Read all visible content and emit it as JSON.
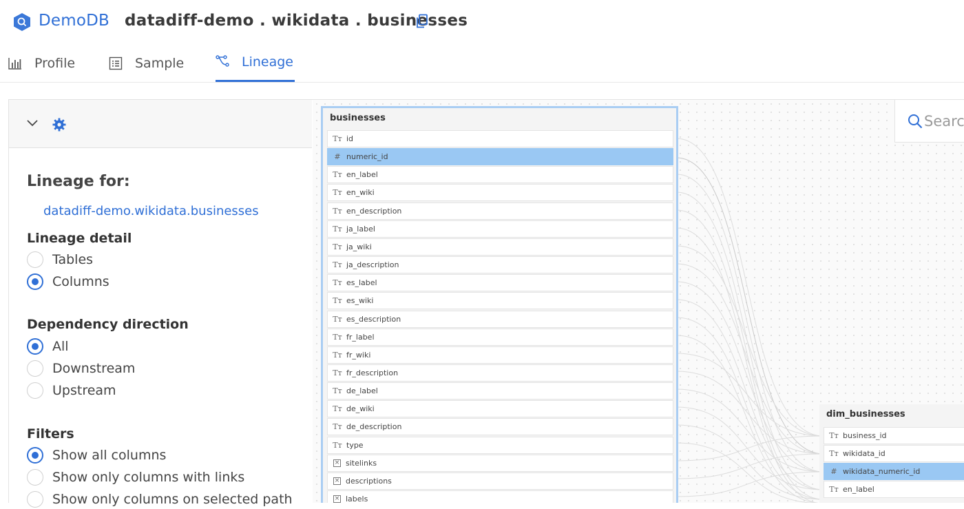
{
  "header": {
    "brand": "DemoDB",
    "table_path": "datadiff-demo . wikidata . businesses",
    "logo_icon": "hexagon-logo-icon",
    "copy_icon": "copy-icon"
  },
  "tabs": [
    {
      "label": "Profile",
      "icon": "bar-chart-icon",
      "active": false
    },
    {
      "label": "Sample",
      "icon": "list-icon",
      "active": false
    },
    {
      "label": "Lineage",
      "icon": "lineage-icon",
      "active": true
    }
  ],
  "panel": {
    "lineage_for_label": "Lineage for:",
    "lineage_for_link": "datadiff-demo.wikidata.businesses",
    "lineage_detail": {
      "title": "Lineage detail",
      "options": [
        {
          "label": "Tables",
          "selected": false
        },
        {
          "label": "Columns",
          "selected": true
        }
      ]
    },
    "dependency_direction": {
      "title": "Dependency direction",
      "options": [
        {
          "label": "All",
          "selected": true
        },
        {
          "label": "Downstream",
          "selected": false
        },
        {
          "label": "Upstream",
          "selected": false
        }
      ]
    },
    "filters": {
      "title": "Filters",
      "options": [
        {
          "label": "Show all columns",
          "selected": true
        },
        {
          "label": "Show only columns with links",
          "selected": false
        },
        {
          "label": "Show only columns on selected path",
          "selected": false
        }
      ]
    }
  },
  "search": {
    "placeholder": "Search"
  },
  "colors": {
    "accent": "#2f6fd6",
    "highlight": "#9ac8f3",
    "selected_border": "#a9cdf3"
  },
  "tables": {
    "businesses": {
      "name": "businesses",
      "columns": [
        {
          "name": "id",
          "type": "text"
        },
        {
          "name": "numeric_id",
          "type": "number",
          "highlighted": true
        },
        {
          "name": "en_label",
          "type": "text"
        },
        {
          "name": "en_wiki",
          "type": "text"
        },
        {
          "name": "en_description",
          "type": "text"
        },
        {
          "name": "ja_label",
          "type": "text"
        },
        {
          "name": "ja_wiki",
          "type": "text"
        },
        {
          "name": "ja_description",
          "type": "text"
        },
        {
          "name": "es_label",
          "type": "text"
        },
        {
          "name": "es_wiki",
          "type": "text"
        },
        {
          "name": "es_description",
          "type": "text"
        },
        {
          "name": "fr_label",
          "type": "text"
        },
        {
          "name": "fr_wiki",
          "type": "text"
        },
        {
          "name": "fr_description",
          "type": "text"
        },
        {
          "name": "de_label",
          "type": "text"
        },
        {
          "name": "de_wiki",
          "type": "text"
        },
        {
          "name": "de_description",
          "type": "text"
        },
        {
          "name": "type",
          "type": "text"
        },
        {
          "name": "sitelinks",
          "type": "struct"
        },
        {
          "name": "descriptions",
          "type": "struct"
        },
        {
          "name": "labels",
          "type": "struct"
        }
      ]
    },
    "dim_businesses": {
      "name": "dim_businesses",
      "columns": [
        {
          "name": "business_id",
          "type": "text"
        },
        {
          "name": "wikidata_id",
          "type": "text"
        },
        {
          "name": "wikidata_numeric_id",
          "type": "number",
          "highlighted": true
        },
        {
          "name": "en_label",
          "type": "text"
        }
      ]
    }
  }
}
